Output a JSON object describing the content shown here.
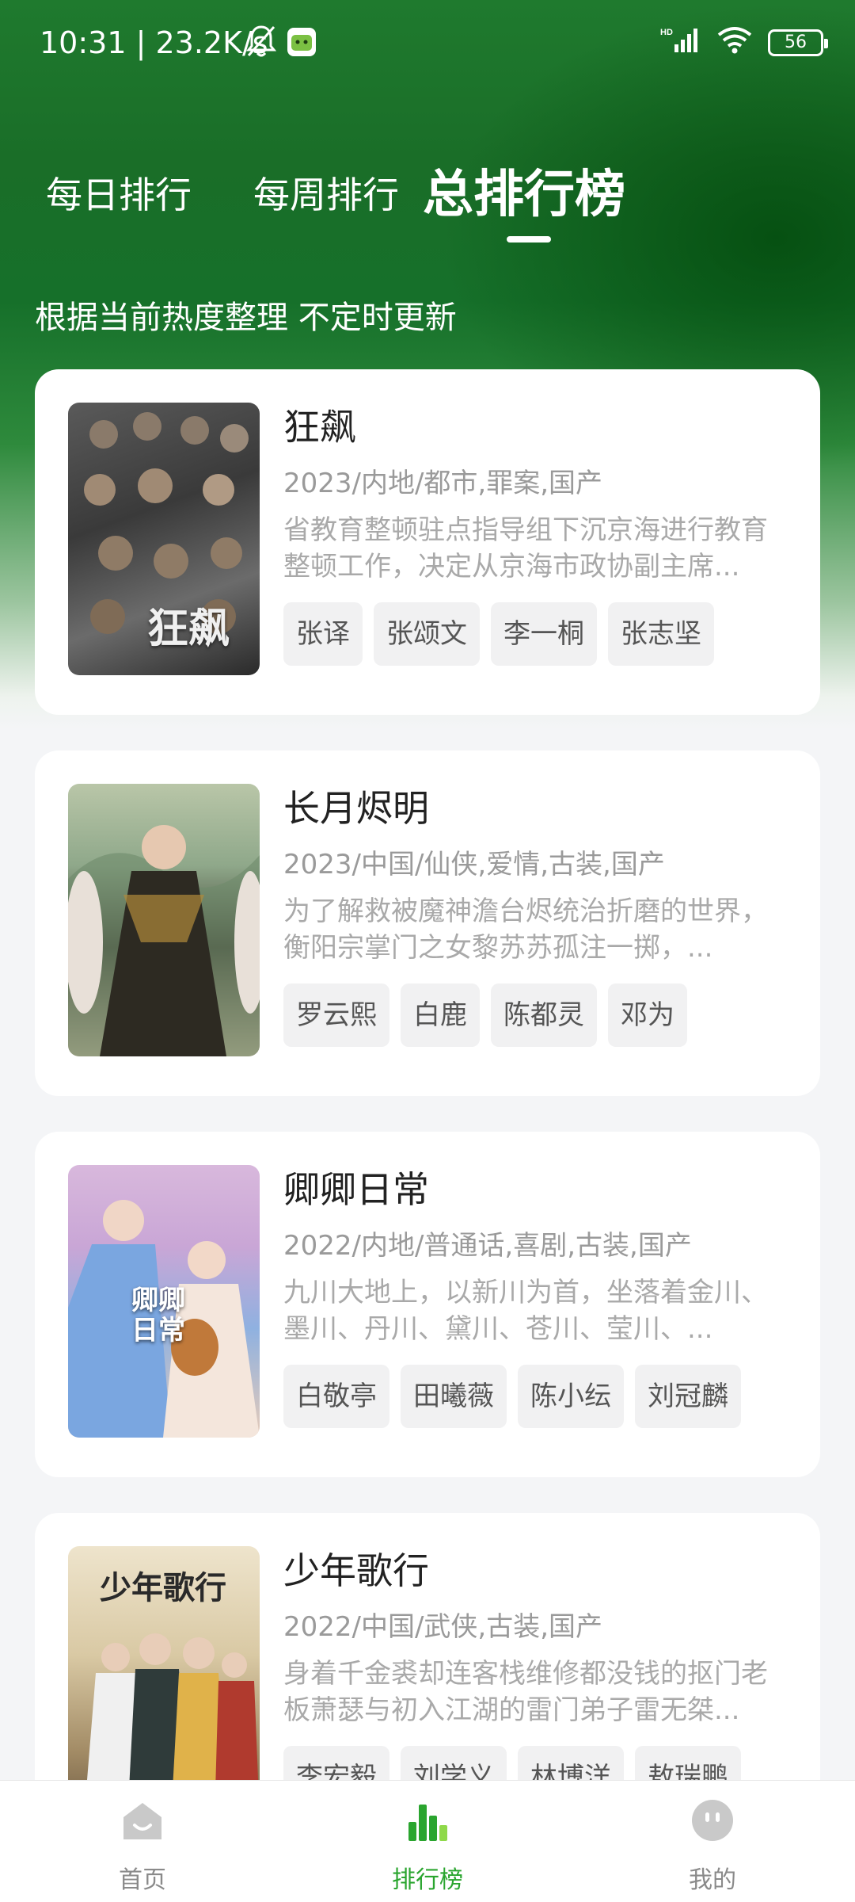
{
  "status_bar": {
    "time_network": "10:31 | 23.2K/s",
    "battery": "56"
  },
  "tabs": [
    {
      "label": "每日排行",
      "active": false
    },
    {
      "label": "每周排行",
      "active": false
    },
    {
      "label": "总排行榜",
      "active": true
    }
  ],
  "subtitle": "根据当前热度整理 不定时更新",
  "items": [
    {
      "title": "狂飙",
      "meta": "2023/内地/都市,罪案,国产",
      "desc": "省教育整顿驻点指导组下沉京海进行教育整顿工作，决定从京海市政协副主席...",
      "tags": [
        "张译",
        "张颂文",
        "李一桐",
        "张志坚"
      ],
      "poster_label": "狂飙",
      "poster_colors": [
        "#3a3a3a",
        "#6b6b6b",
        "#2a2a2a"
      ]
    },
    {
      "title": "长月烬明",
      "meta": "2023/中国/仙侠,爱情,古装,国产",
      "desc": "为了解救被魔神澹台烬统治折磨的世界，衡阳宗掌门之女黎苏苏孤注一掷，...",
      "tags": [
        "罗云熙",
        "白鹿",
        "陈都灵",
        "邓为"
      ],
      "poster_label": "",
      "poster_colors": [
        "#a8b89a",
        "#3b3a2e",
        "#c9b59a"
      ]
    },
    {
      "title": "卿卿日常",
      "meta": "2022/内地/普通话,喜剧,古装,国产",
      "desc": "九川大地上，以新川为首，坐落着金川、墨川、丹川、黛川、苍川、莹川、...",
      "tags": [
        "白敬亭",
        "田曦薇",
        "陈小纭",
        "刘冠麟"
      ],
      "poster_label": "卿卿日常",
      "poster_colors": [
        "#d7b8d8",
        "#6f9fd6",
        "#e2c7b6"
      ]
    },
    {
      "title": "少年歌行",
      "meta": "2022/中国/武侠,古装,国产",
      "desc": "身着千金裘却连客栈维修都没钱的抠门老板萧瑟与初入江湖的雷门弟子雷无桀...",
      "tags": [
        "李宏毅",
        "刘学义",
        "林博洋",
        "敖瑞鹏"
      ],
      "poster_label": "少年歌行",
      "poster_colors": [
        "#e8dcc0",
        "#b5a27a",
        "#6d5a42"
      ]
    }
  ],
  "bottom_nav": [
    {
      "label": "首页",
      "icon": "home-icon",
      "active": false
    },
    {
      "label": "排行榜",
      "icon": "ranking-icon",
      "active": true
    },
    {
      "label": "我的",
      "icon": "profile-icon",
      "active": false
    }
  ],
  "colors": {
    "header_green": "#1a6e28",
    "accent_green": "#2aa52f"
  }
}
